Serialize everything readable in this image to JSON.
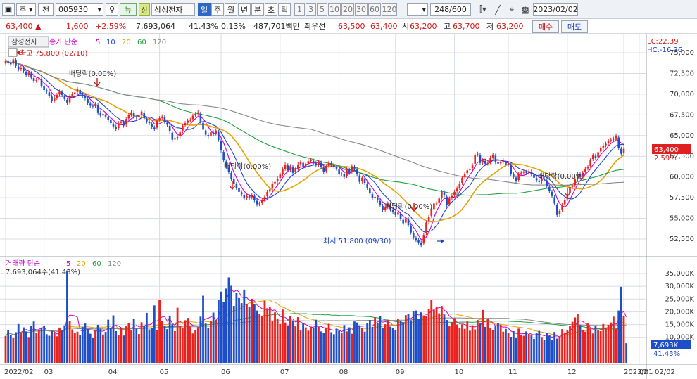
{
  "toolbar": {
    "market": "주",
    "type": "전",
    "code": "005930",
    "name": "삼성전자",
    "sin_badge": "신",
    "nyu_badge": "뉴",
    "periods": [
      "일",
      "주",
      "월",
      "년",
      "분",
      "초",
      "틱"
    ],
    "active_period": "일",
    "minutes": [
      "1",
      "3",
      "5",
      "10",
      "20",
      "30",
      "60",
      "120"
    ],
    "count": "248/600",
    "date": "2023/02/02"
  },
  "info": {
    "price": "63,400",
    "arrow": "▲",
    "change": "1,600",
    "change_pct": "+2.59%",
    "volume": "7,693,064",
    "vol_ratio": "41.43%",
    "turnover": "0.13%",
    "amount": "487,701백만",
    "pref_label": "최우선",
    "ask": "63,500",
    "bid": "63,400",
    "open_label": "시",
    "open": "63,200",
    "high_label": "고",
    "high": "63,700",
    "low_label": "저",
    "low": "63,200",
    "buy_label": "매수",
    "sell_label": "매도"
  },
  "legend": {
    "stock": "삼성전자",
    "ma_label": "종가 단순",
    "ma_periods": [
      "5",
      "10",
      "20",
      "60",
      "120"
    ],
    "ma_colors": [
      "#cc00cc",
      "#2040d0",
      "#e6a000",
      "#20a040",
      "#888888"
    ],
    "vol_label": "거래량 단순",
    "vol_periods": [
      "5",
      "20",
      "60",
      "120"
    ],
    "vol_colors": [
      "#cc00cc",
      "#e6a000",
      "#20a040",
      "#888888"
    ],
    "vol_current": "7,693,064주(41.43%)",
    "lc": "LC:22.39",
    "hc": "HC:-16.36"
  },
  "annotations": {
    "high": "최고 75,800 (02/10)",
    "low": "최저 51,800 (09/30)",
    "div": "배당락(0.00%)"
  },
  "price_axis": {
    "labels": [
      "75,000",
      "72,500",
      "70,000",
      "67,500",
      "65,000",
      "62,500",
      "60,000",
      "57,500",
      "55,000",
      "52,500"
    ],
    "current": "63,400",
    "current_pct": "2.59%"
  },
  "volume_axis": {
    "labels": [
      "35,000K",
      "30,000K",
      "25,000K",
      "20,000K",
      "15,000K",
      "10,000K"
    ],
    "current": "7,693K",
    "current_pct": "41.43%"
  },
  "x_axis": [
    "2022/02",
    "03",
    "04",
    "05",
    "06",
    "07",
    "08",
    "09",
    "10",
    "11",
    "12",
    "2023/01",
    "02",
    "02/02"
  ],
  "colors": {
    "up": "#e8221e",
    "down": "#1f4fc8",
    "bg": "#ffffff",
    "grid": "#d8dce4"
  },
  "chart_data": {
    "type": "candlestick",
    "ylim": [
      51000,
      76500
    ],
    "vol_ylim": [
      0,
      36500000
    ],
    "close": [
      74000,
      73800,
      73600,
      74200,
      73400,
      73000,
      73200,
      72800,
      72300,
      72600,
      72000,
      71600,
      71700,
      71900,
      71000,
      70500,
      70300,
      69800,
      69200,
      69500,
      69900,
      70300,
      69900,
      69400,
      68900,
      69700,
      70000,
      70200,
      70600,
      70000,
      69800,
      69500,
      68900,
      68600,
      68500,
      68800,
      67800,
      67400,
      67600,
      67300,
      66900,
      66500,
      66100,
      65800,
      66500,
      66700,
      66200,
      67000,
      67500,
      67800,
      67300,
      67200,
      67400,
      67900,
      67100,
      66700,
      66500,
      66000,
      65800,
      66800,
      67100,
      67300,
      66600,
      66300,
      65500,
      64500,
      64700,
      64800,
      65400,
      66200,
      66500,
      66800,
      66900,
      67400,
      67600,
      67800,
      66700,
      65700,
      65100,
      64900,
      65400,
      65200,
      65600,
      64500,
      63200,
      62000,
      61200,
      60600,
      59800,
      59200,
      58700,
      58200,
      57900,
      57400,
      57700,
      57500,
      57800,
      57200,
      56700,
      56800,
      57200,
      57600,
      58200,
      58500,
      59200,
      59400,
      59800,
      60300,
      60900,
      61500,
      60800,
      61300,
      60500,
      60900,
      61500,
      61800,
      61200,
      61600,
      61900,
      62000,
      61700,
      61400,
      61800,
      61200,
      60600,
      61300,
      61700,
      61500,
      61200,
      61000,
      60300,
      60400,
      60000,
      60900,
      60500,
      61300,
      61000,
      60300,
      59400,
      59900,
      59300,
      58700,
      58000,
      57500,
      57600,
      57200,
      56600,
      56000,
      56300,
      56800,
      56100,
      55800,
      55400,
      55700,
      54900,
      54400,
      55000,
      54200,
      53300,
      52700,
      52400,
      52100,
      51800,
      53000,
      54500,
      55200,
      56000,
      56800,
      56800,
      57400,
      58200,
      57800,
      56600,
      57400,
      57700,
      58200,
      58600,
      59200,
      59900,
      60400,
      60800,
      61000,
      61400,
      62700,
      62800,
      61700,
      62000,
      61600,
      61700,
      62300,
      62700,
      61800,
      61600,
      61800,
      62000,
      61500,
      61600,
      60400,
      60000,
      59500,
      60400,
      60500,
      60600,
      60500,
      60700,
      60300,
      59900,
      59600,
      59400,
      59800,
      59700,
      58900,
      58300,
      57700,
      56800,
      55400,
      55900,
      56600,
      57200,
      57900,
      58800,
      58900,
      59700,
      60400,
      60000,
      60500,
      61000,
      61200,
      62100,
      62600,
      62300,
      63000,
      63500,
      63800,
      64000,
      64400,
      64500,
      64600,
      65000,
      63500,
      62800,
      63400
    ],
    "volume": [
      10500000,
      12800000,
      11000000,
      9800000,
      12000000,
      15200000,
      11800000,
      13900000,
      12300000,
      10100000,
      14400000,
      16200000,
      11600000,
      12900000,
      13700000,
      14600000,
      11200000,
      10600000,
      12500000,
      11900000,
      10400000,
      13800000,
      12600000,
      14700000,
      36200000,
      16400000,
      13100000,
      11700000,
      12200000,
      10800000,
      14100000,
      15400000,
      13200000,
      11400000,
      9900000,
      12700000,
      14900000,
      13300000,
      11100000,
      12100000,
      16900000,
      13600000,
      18600000,
      12400000,
      10900000,
      13500000,
      10700000,
      14300000,
      15700000,
      12900000,
      17100000,
      13400000,
      11300000,
      15900000,
      14500000,
      19600000,
      13100000,
      13700000,
      22500000,
      12800000,
      24600000,
      16300000,
      14600000,
      13200000,
      18200000,
      15100000,
      12400000,
      21600000,
      14400000,
      13600000,
      16700000,
      17600000,
      14200000,
      11500000,
      12700000,
      13900000,
      18100000,
      26300000,
      15400000,
      13800000,
      16400000,
      19700000,
      16800000,
      24800000,
      27900000,
      23800000,
      29100000,
      33500000,
      30200000,
      22300000,
      27500000,
      25400000,
      23400000,
      28700000,
      22900000,
      21800000,
      25100000,
      23100000,
      20500000,
      19200000,
      18400000,
      24300000,
      21400000,
      22000000,
      16400000,
      19800000,
      17400000,
      15200000,
      20900000,
      15800000,
      14700000,
      18300000,
      16600000,
      14500000,
      17900000,
      12800000,
      15700000,
      13900000,
      12600000,
      14200000,
      13800000,
      16900000,
      14100000,
      12300000,
      11700000,
      13500000,
      15300000,
      12000000,
      11200000,
      13400000,
      12600000,
      11800000,
      14800000,
      12300000,
      13900000,
      11400000,
      16200000,
      15800000,
      14700000,
      13500000,
      12200000,
      15600000,
      16800000,
      14100000,
      17900000,
      15600000,
      18300000,
      13700000,
      15100000,
      16900000,
      14200000,
      13600000,
      12900000,
      17100000,
      16300000,
      15900000,
      18700000,
      19200000,
      16700000,
      20100000,
      20500000,
      17300000,
      19800000,
      18600000,
      18400000,
      21200000,
      24800000,
      20700000,
      21900000,
      19400000,
      22300000,
      18900000,
      16800000,
      14400000,
      15900000,
      17500000,
      15000000,
      13800000,
      15100000,
      13300000,
      16200000,
      12600000,
      14700000,
      13100000,
      16800000,
      15400000,
      20700000,
      14100000,
      17200000,
      13800000,
      12900000,
      14300000,
      15600000,
      14900000,
      12200000,
      13300000,
      11700000,
      10200000,
      12400000,
      9800000,
      13400000,
      11000000,
      10600000,
      12300000,
      11300000,
      10900000,
      9400000,
      11800000,
      12500000,
      10100000,
      9100000,
      11600000,
      10600000,
      8800000,
      12100000,
      9500000,
      10300000,
      13200000,
      11900000,
      12700000,
      14300000,
      16100000,
      17800000,
      19300000,
      14800000,
      13000000,
      12200000,
      15400000,
      13700000,
      11500000,
      14600000,
      12800000,
      12400000,
      15200000,
      13600000,
      14900000,
      15800000,
      18100000,
      13400000,
      20500000,
      29800000,
      18500000,
      7693064
    ],
    "series": [
      {
        "name": "5"
      },
      {
        "name": "10"
      },
      {
        "name": "20"
      },
      {
        "name": "60"
      },
      {
        "name": "120"
      }
    ]
  }
}
